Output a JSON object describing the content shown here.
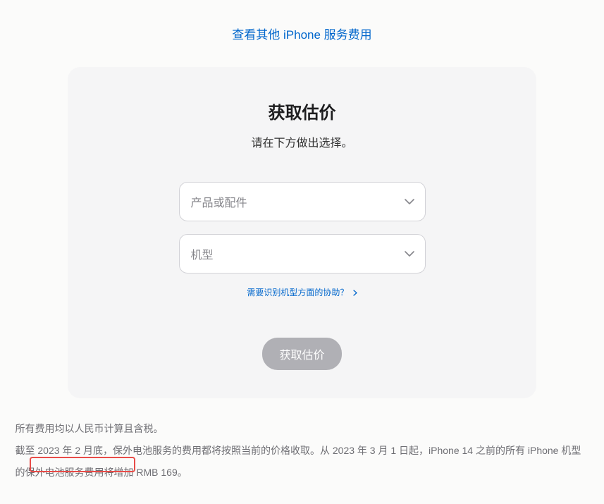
{
  "topLink": "查看其他 iPhone 服务费用",
  "card": {
    "title": "获取估价",
    "subtitle": "请在下方做出选择。",
    "select1": "产品或配件",
    "select2": "机型",
    "helpLink": "需要识别机型方面的协助？",
    "submit": "获取估价"
  },
  "footer": {
    "line1": "所有费用均以人民币计算且含税。",
    "line2": "截至 2023 年 2 月底，保外电池服务的费用都将按照当前的价格收取。从 2023 年 3 月 1 日起，iPhone 14 之前的所有 iPhone 机型的保外电池服务费用将增加 RMB 169。"
  }
}
